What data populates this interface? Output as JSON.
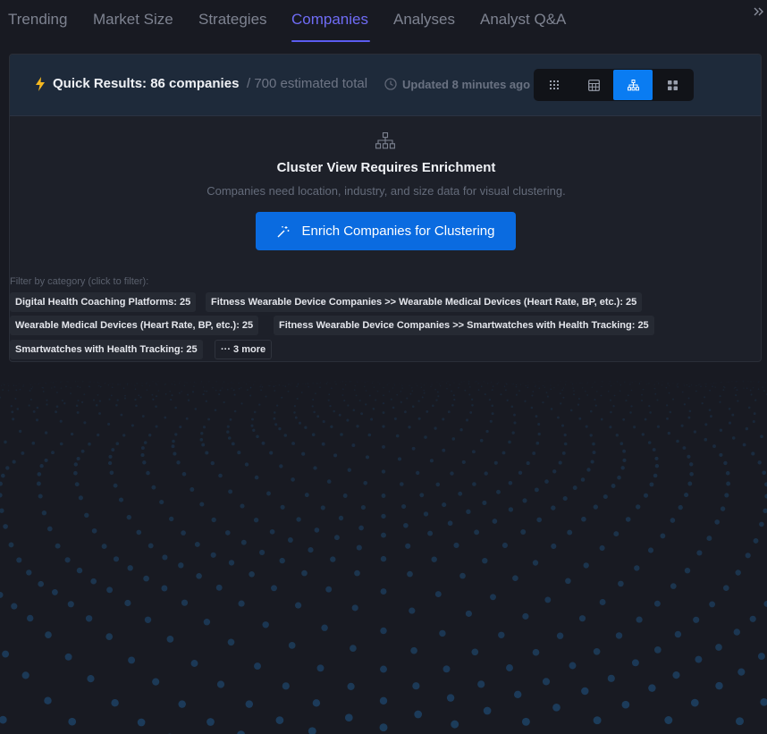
{
  "tabs": [
    {
      "label": "Trending",
      "active": false
    },
    {
      "label": "Market Size",
      "active": false
    },
    {
      "label": "Strategies",
      "active": false
    },
    {
      "label": "Companies",
      "active": true
    },
    {
      "label": "Analyses",
      "active": false
    },
    {
      "label": "Analyst Q&A",
      "active": false
    }
  ],
  "collapse_icon": "double-chevron-right-icon",
  "header": {
    "icon": "lightning-icon",
    "title": "Quick Results: 86 companies",
    "total": "/ 700 estimated total",
    "updated_icon": "clock-icon",
    "updated": "Updated 8 minutes ago"
  },
  "view_toggle": [
    {
      "icon": "dot-grid-icon",
      "active": false
    },
    {
      "icon": "table-icon",
      "active": false
    },
    {
      "icon": "cluster-icon",
      "active": true
    },
    {
      "icon": "card-grid-icon",
      "active": false
    }
  ],
  "empty_state": {
    "icon": "cluster-icon",
    "title": "Cluster View Requires Enrichment",
    "subtitle": "Companies need location, industry, and size data for visual clustering.",
    "button_icon": "magic-wand-icon",
    "button_label": "Enrich Companies for Clustering"
  },
  "filter": {
    "label": "Filter by category (click to filter):",
    "chips": [
      "Digital Health Coaching Platforms: 25",
      "Fitness Wearable Device Companies >> Wearable Medical Devices (Heart Rate, BP, etc.): 25",
      "Wearable Medical Devices (Heart Rate, BP, etc.): 25",
      "Fitness Wearable Device Companies >> Smartwatches with Health Tracking: 25",
      "Smartwatches with Health Tracking: 25"
    ],
    "more_label": "··· 3 more"
  },
  "colors": {
    "background": "#181a22",
    "accent": "#0a6be0",
    "active_tab": "#6f6cf5",
    "dots": "#1f4f7a"
  }
}
